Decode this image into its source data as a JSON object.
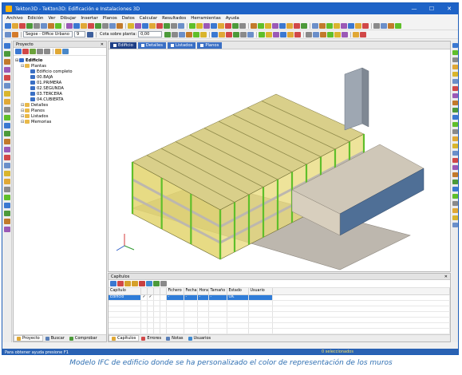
{
  "window": {
    "title": "Tekton3D - TeKton3D: Edificación e Instalaciones 3D",
    "buttons": [
      "—",
      "☐",
      "✕"
    ]
  },
  "menubar": [
    "Archivo",
    "Edición",
    "Ver",
    "Dibujar",
    "Insertar",
    "Planos",
    "Datos",
    "Calcular",
    "Resultados",
    "Herramientas",
    "Ayuda"
  ],
  "toolbar2": {
    "font_value": "Segoe - Office Urbano",
    "font_size": "9",
    "cota_label": "Cota sobre planta:",
    "cota_value": "0,00"
  },
  "project_panel": {
    "title": "Proyecto",
    "tree": [
      {
        "label": "Edificio",
        "level": 0,
        "icon": "building-icon",
        "bold": true
      },
      {
        "label": "Plantas",
        "level": 1,
        "icon": "folder-icon"
      },
      {
        "label": "Edificio completo",
        "level": 2,
        "icon": "plan-icon"
      },
      {
        "label": "00.BAJA",
        "level": 2,
        "icon": "plan-icon"
      },
      {
        "label": "01.PRIMERA",
        "level": 2,
        "icon": "plan-icon"
      },
      {
        "label": "02.SEGUNDA",
        "level": 2,
        "icon": "plan-icon"
      },
      {
        "label": "03.TERCERA",
        "level": 2,
        "icon": "plan-icon"
      },
      {
        "label": "04.CUBIERTA",
        "level": 2,
        "icon": "plan-icon"
      },
      {
        "label": "Detalles",
        "level": 1,
        "icon": "folder-icon"
      },
      {
        "label": "Planos",
        "level": 1,
        "icon": "folder-icon"
      },
      {
        "label": "Listados",
        "level": 1,
        "icon": "folder-icon"
      },
      {
        "label": "Memorias",
        "level": 1,
        "icon": "folder-icon"
      }
    ],
    "bottom_tabs": [
      "Proyecto",
      "Buscar",
      "Comprobar"
    ]
  },
  "viewport": {
    "tabs": [
      "Edificio",
      "Detalles",
      "Listados",
      "Planos"
    ]
  },
  "capitulos_panel": {
    "title": "Capítulos",
    "columns": [
      "Capítulo",
      "",
      "",
      "",
      "",
      "Fichero",
      "Fecha",
      "Hora",
      "Tamaño",
      "Estado",
      "Usuario"
    ],
    "rows": [
      [
        "Edificio",
        "✓",
        "✓",
        "",
        "",
        "-",
        "-",
        "-",
        "-",
        "OK",
        ""
      ]
    ],
    "bottom_tabs": [
      "Capítulos",
      "Errores",
      "Notas",
      "Usuarios"
    ]
  },
  "statusbar": {
    "left": "Para obtener ayuda presione F1",
    "right": "0 seleccionados"
  },
  "caption": "Modelo IFC de edificio donde se ha personalizado el color de representación de los muros",
  "colors": {
    "title_bar": "#1e63c7",
    "status_bar": "#2a62b3",
    "wall_yellow": "#e6d36b",
    "slab_gray": "#bdb7ae",
    "structure_green": "#5fbf2a",
    "caption_blue": "#2f6fb2"
  }
}
